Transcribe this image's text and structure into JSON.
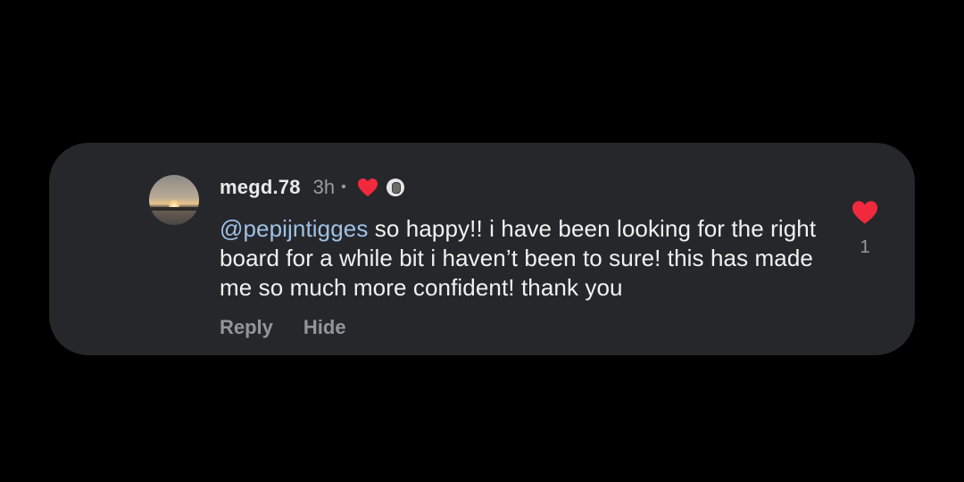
{
  "comment": {
    "username": "megd.78",
    "time": "3h",
    "separator": "•",
    "mention": "@pepijntigges",
    "text": " so happy!! i have been looking for the right board for a while bit i haven’t been to sure! this has made me so much more confident! thank you",
    "actions": {
      "reply": "Reply",
      "hide": "Hide"
    },
    "like_count": "1"
  },
  "colors": {
    "background": "#000000",
    "card": "#26272b",
    "heart": "#f02a3c",
    "mention": "#9fc1e6",
    "secondary_text": "#9a9b9f"
  },
  "icons": {
    "creator_like": "heart-icon",
    "creator_badge": "creator-avatar-badge-icon",
    "like": "heart-icon"
  }
}
